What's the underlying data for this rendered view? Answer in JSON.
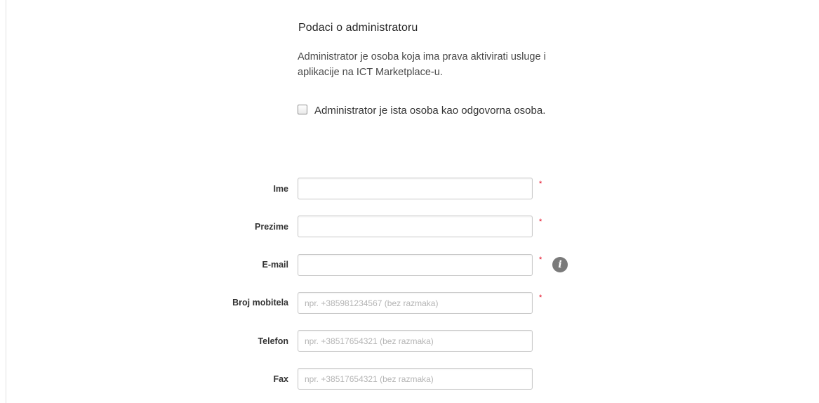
{
  "section": {
    "title": "Podaci o administratoru",
    "description": "Administrator je osoba koja ima prava aktivirati usluge i aplikacije na ICT Marketplace-u.",
    "checkbox_label": "Administrator je ista osoba kao odgovorna osoba.",
    "checkbox_checked": false
  },
  "form": {
    "fields": [
      {
        "label": "Ime",
        "value": "",
        "placeholder": "",
        "required": true
      },
      {
        "label": "Prezime",
        "value": "",
        "placeholder": "",
        "required": true
      },
      {
        "label": "E-mail",
        "value": "",
        "placeholder": "",
        "required": true,
        "info_icon": "info-icon"
      },
      {
        "label": "Broj mobitela",
        "value": "",
        "placeholder": "npr. +385981234567 (bez razmaka)",
        "required": true
      },
      {
        "label": "Telefon",
        "value": "",
        "placeholder": "npr. +38517654321 (bez razmaka)",
        "required": false
      },
      {
        "label": "Fax",
        "value": "",
        "placeholder": "npr. +38517654321 (bez razmaka)",
        "required": false
      }
    ],
    "required_marker": "*",
    "info_glyph": "i"
  },
  "colors": {
    "required": "#e2001a",
    "info_icon_bg": "#7a7a7a",
    "input_border": "#c9c9c9"
  }
}
